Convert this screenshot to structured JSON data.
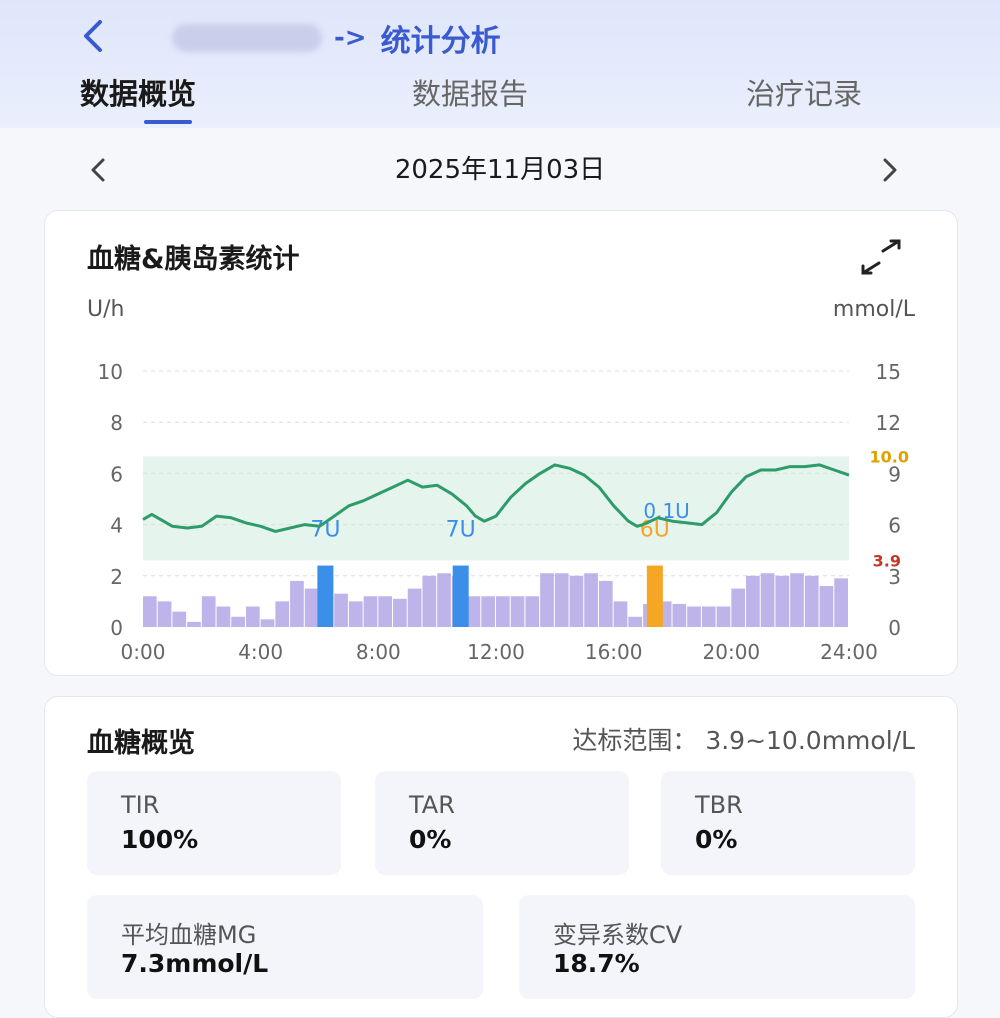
{
  "header": {
    "back_icon": "chevron-left-icon",
    "nav_arrow": "->",
    "title": "统计分析",
    "tabs": [
      {
        "label": "数据概览",
        "active": true
      },
      {
        "label": "数据报告",
        "active": false
      },
      {
        "label": "治疗记录",
        "active": false
      }
    ]
  },
  "date_nav": {
    "date": "2025年11月03日",
    "prev_icon": "chevron-left-icon",
    "next_icon": "chevron-right-icon"
  },
  "chart_card": {
    "title": "血糖&胰岛素统计",
    "expand_icon": "expand-icon",
    "left_unit": "U/h",
    "right_unit": "mmol/L"
  },
  "chart_data": {
    "type": "line",
    "title": "血糖&胰岛素统计",
    "x_ticks": [
      "0:00",
      "4:00",
      "8:00",
      "12:00",
      "16:00",
      "20:00",
      "24:00"
    ],
    "xlim": [
      0,
      24
    ],
    "y_left": {
      "unit": "U/h",
      "ticks": [
        0,
        2,
        4,
        6,
        8,
        10
      ],
      "ylim": [
        0,
        10
      ]
    },
    "y_right": {
      "unit": "mmol/L",
      "ticks": [
        0,
        3,
        6,
        9,
        12,
        15
      ],
      "ylim": [
        0,
        15
      ]
    },
    "target_range": {
      "low": 3.9,
      "high": 10.0,
      "low_label": "3.9",
      "high_label": "10.0"
    },
    "colors": {
      "glucose": "#2e9b6a",
      "basal": "#a99be3",
      "bolus": "#3b8fe8",
      "meal": "#f5a623",
      "target_band": "#e6f4ee",
      "low_label": "#c0392b",
      "high_label": "#e0a100"
    },
    "glucose_series": {
      "axis": "right",
      "x": [
        0,
        0.3,
        0.7,
        1.0,
        1.5,
        2.0,
        2.5,
        3.0,
        3.5,
        4.0,
        4.5,
        5.0,
        5.5,
        6.0,
        6.5,
        7.0,
        7.5,
        8.0,
        8.5,
        9.0,
        9.5,
        10.0,
        10.5,
        11.0,
        11.3,
        11.6,
        12.0,
        12.5,
        13.0,
        13.5,
        14.0,
        14.5,
        15.0,
        15.5,
        16.0,
        16.5,
        16.8,
        17.0,
        17.5,
        18.0,
        18.5,
        19.0,
        19.5,
        20.0,
        20.5,
        21.0,
        21.5,
        22.0,
        22.5,
        23.0,
        23.5,
        24.0
      ],
      "y": [
        6.3,
        6.6,
        6.2,
        5.9,
        5.8,
        5.9,
        6.5,
        6.4,
        6.1,
        5.9,
        5.6,
        5.8,
        6.0,
        5.9,
        6.5,
        7.1,
        7.4,
        7.8,
        8.2,
        8.6,
        8.2,
        8.3,
        7.8,
        7.1,
        6.5,
        6.2,
        6.5,
        7.6,
        8.4,
        9.0,
        9.5,
        9.3,
        8.9,
        8.2,
        7.1,
        6.2,
        5.9,
        6.0,
        6.4,
        6.2,
        6.1,
        6.0,
        6.7,
        7.9,
        8.8,
        9.2,
        9.2,
        9.4,
        9.4,
        9.5,
        9.2,
        8.9
      ]
    },
    "basal_series": {
      "axis": "left",
      "x": [
        0,
        0.5,
        1,
        1.5,
        2,
        2.5,
        3,
        3.5,
        4,
        4.5,
        5,
        5.5,
        6,
        6.5,
        7,
        7.5,
        8,
        8.5,
        9,
        9.5,
        10,
        10.5,
        11,
        11.5,
        12,
        12.5,
        13,
        13.5,
        14,
        14.5,
        15,
        15.5,
        16,
        16.5,
        17,
        17.5,
        18,
        18.5,
        19,
        19.5,
        20,
        20.5,
        21,
        21.5,
        22,
        22.5,
        23,
        23.5,
        24
      ],
      "y": [
        1.2,
        1.0,
        0.6,
        0.2,
        1.2,
        0.8,
        0.4,
        0.8,
        0.3,
        1.0,
        1.8,
        1.5,
        2.0,
        1.3,
        1.0,
        1.2,
        1.2,
        1.1,
        1.5,
        2.0,
        2.1,
        2.0,
        1.2,
        1.2,
        1.2,
        1.2,
        1.2,
        2.1,
        2.1,
        2.0,
        2.1,
        1.8,
        1.0,
        0.4,
        0.9,
        1.0,
        0.9,
        0.8,
        0.8,
        0.8,
        1.5,
        2.0,
        2.1,
        2.0,
        2.1,
        2.0,
        1.6,
        1.9,
        0.9
      ]
    },
    "bolus_events": [
      {
        "x": 6.2,
        "value": 7,
        "label": "7U",
        "kind": "bolus"
      },
      {
        "x": 10.8,
        "value": 7,
        "label": "7U",
        "kind": "bolus"
      },
      {
        "x": 17.4,
        "value": 6,
        "label": "6U",
        "kind": "meal"
      }
    ],
    "extra_labels": [
      {
        "x": 17.8,
        "text": "0.1U"
      }
    ]
  },
  "overview_card": {
    "title": "血糖概览",
    "range_text": "达标范围： 3.9~10.0mmol/L",
    "metrics": [
      {
        "label": "TIR",
        "value": "100%"
      },
      {
        "label": "TAR",
        "value": "0%"
      },
      {
        "label": "TBR",
        "value": "0%"
      },
      {
        "label": "平均血糖MG",
        "value": "7.3mmol/L"
      },
      {
        "label": "变异系数CV",
        "value": "18.7%"
      }
    ]
  }
}
